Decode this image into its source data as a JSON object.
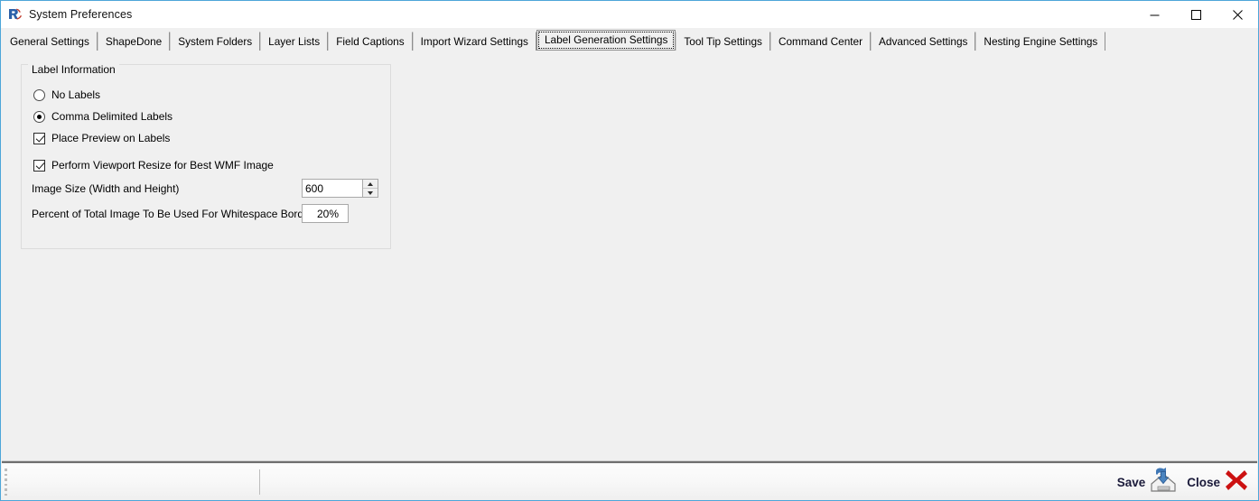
{
  "window": {
    "title": "System Preferences",
    "icon": "app-logo-r-icon",
    "controls": {
      "minimize": "minimize-icon",
      "maximize": "maximize-icon",
      "close": "close-icon"
    },
    "border_color": "#4da6d9",
    "background_color": "#f0f0f0"
  },
  "tabs": [
    {
      "label": "General Settings",
      "selected": false
    },
    {
      "label": "ShapeDone",
      "selected": false
    },
    {
      "label": "System Folders",
      "selected": false
    },
    {
      "label": "Layer Lists",
      "selected": false
    },
    {
      "label": "Field Captions",
      "selected": false
    },
    {
      "label": "Import Wizard Settings",
      "selected": false
    },
    {
      "label": "Label Generation Settings",
      "selected": true
    },
    {
      "label": "Tool Tip Settings",
      "selected": false
    },
    {
      "label": "Command Center",
      "selected": false
    },
    {
      "label": "Advanced Settings",
      "selected": false
    },
    {
      "label": "Nesting Engine Settings",
      "selected": false
    }
  ],
  "label_generation": {
    "group_title": "Label Information",
    "radios": [
      {
        "label": "No Labels",
        "checked": false
      },
      {
        "label": "Comma Delimited Labels",
        "checked": true
      }
    ],
    "checkboxes": [
      {
        "label": "Place Preview on Labels",
        "checked": true
      },
      {
        "label": "Perform Viewport Resize for Best WMF Image",
        "checked": true
      }
    ],
    "image_size": {
      "label": "Image Size (Width and Height)",
      "value": "600"
    },
    "whitespace_border": {
      "label": "Percent of Total Image To Be Used For Whitespace Border",
      "value": "20%"
    }
  },
  "statusbar": {
    "grip": "resize-grip-icon",
    "panel_1_text": "",
    "panel_2_text": "",
    "save_label": "Save",
    "save_icon": "save-disk-icon",
    "close_label": "Close",
    "close_icon": "close-red-x-icon",
    "save_icon_color": "#3a6ea5",
    "close_icon_color": "#cc0000"
  }
}
